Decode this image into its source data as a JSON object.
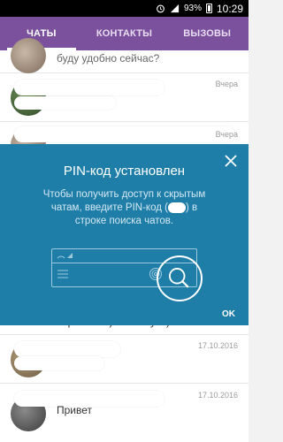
{
  "status_bar": {
    "battery_percent": "93%",
    "time": "10:29"
  },
  "tabs": [
    {
      "label": "ЧАТЫ",
      "active": true
    },
    {
      "label": "КОНТАКТЫ",
      "active": false
    },
    {
      "label": "ВЫЗОВЫ",
      "active": false
    }
  ],
  "chats": [
    {
      "preview": "буду удобно сейчас?",
      "date": ""
    },
    {
      "preview": "",
      "date": "Вчера"
    },
    {
      "preview": "",
      "date": "Вчера"
    },
    {
      "preview": "серьезный) в галстуке)",
      "date": ""
    },
    {
      "preview": "",
      "date": "17.10.2016"
    },
    {
      "preview": "Привет",
      "date": "17.10.2016"
    }
  ],
  "pin_overlay": {
    "title": "PIN-код установлен",
    "desc_part1": "Чтобы получить доступ к скрытым чатам, введите PIN-код",
    "desc_part2": "в строке поиска чатов.",
    "ok_label": "OK"
  },
  "colors": {
    "tab_bar": "#7b519d",
    "overlay": "#1f7ea8"
  }
}
